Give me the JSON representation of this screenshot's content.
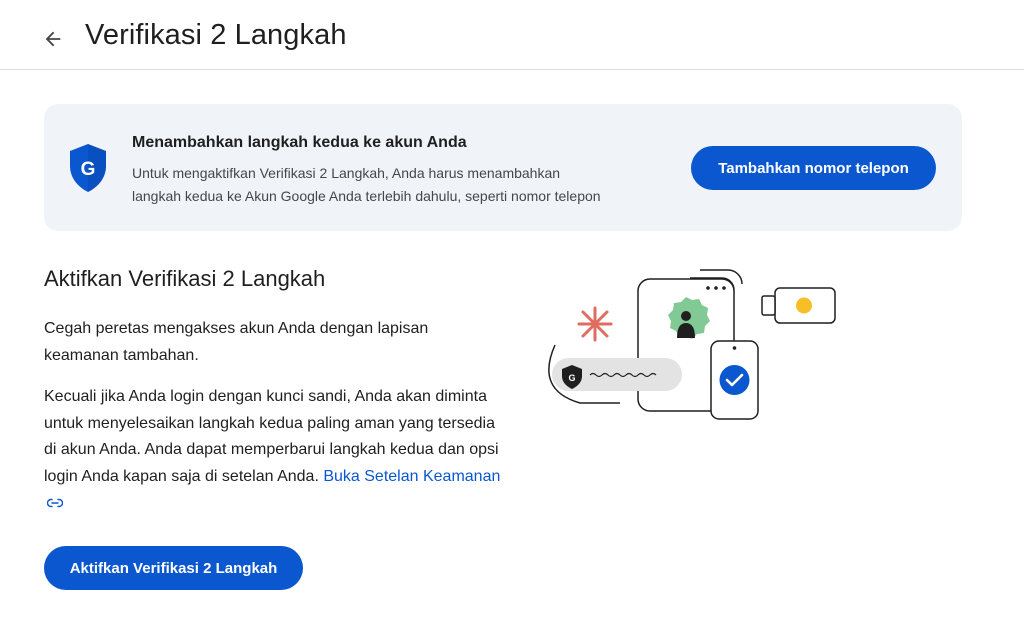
{
  "header": {
    "title": "Verifikasi 2 Langkah",
    "back_icon": "arrow-back-icon"
  },
  "banner": {
    "icon": "google-shield-icon",
    "shield_letter": "G",
    "heading": "Menambahkan langkah kedua ke akun Anda",
    "body_line1": "Untuk mengaktifkan Verifikasi 2 Langkah, Anda harus menambahkan",
    "body_line2": "langkah kedua ke Akun Google Anda terlebih dahulu, seperti nomor telepon",
    "button_label": "Tambahkan nomor telepon"
  },
  "main": {
    "title": "Aktifkan Verifikasi 2 Langkah",
    "para1": "Cegah peretas mengakses akun Anda dengan lapisan keamanan tambahan.",
    "para2": "Kecuali jika Anda login dengan kunci sandi, Anda akan diminta untuk menyelesaikan langkah kedua paling aman yang tersedia di akun Anda. Anda dapat memperbarui langkah kedua dan opsi login Anda kapan saja di setelan Anda.",
    "link_label": "Buka Setelan Keamanan",
    "link_icon": "link-icon",
    "button_label": "Aktifkan Verifikasi 2 Langkah"
  },
  "illustration": {
    "description_icon": "two-step-verification-illustration",
    "colors": {
      "accent_blue": "#0b57d0",
      "green_badge": "#81c995",
      "yellow_dot": "#f6bf26",
      "red_asterisk": "#e06c5f",
      "pill_gray": "#e3e3e3"
    }
  },
  "theme": {
    "primary": "#0b57d0",
    "banner_bg": "#f0f4f9",
    "divider": "#dadce0",
    "text": "#1f1f1f"
  }
}
